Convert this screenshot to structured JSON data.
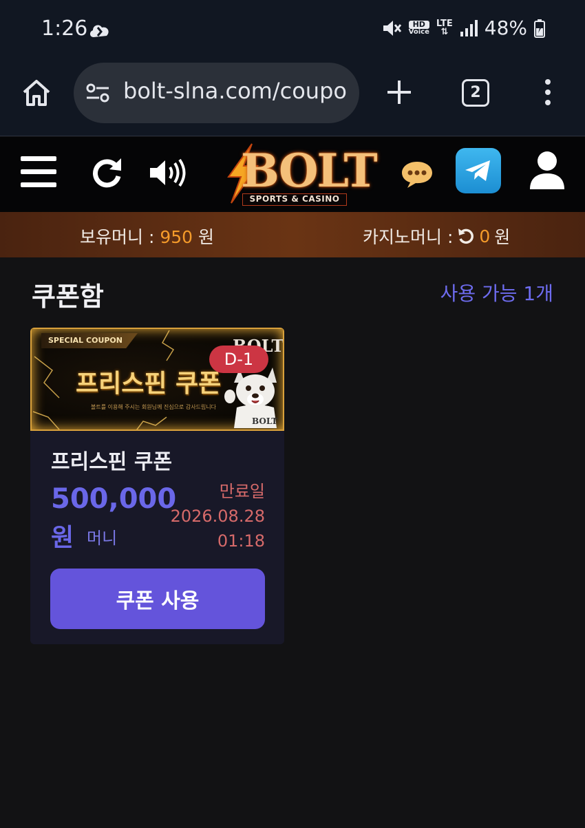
{
  "status_bar": {
    "time": "1:26",
    "battery": "48%",
    "hd_label": "HD",
    "voice_label": "Voice",
    "network": "LTE"
  },
  "browser": {
    "url": "bolt-slna.com/coupo",
    "tab_count": "2"
  },
  "header": {
    "logo_text": "BOLT",
    "logo_subtitle": "SPORTS & CASINO"
  },
  "money": {
    "holding_label": "보유머니 :",
    "holding_value": "950",
    "holding_unit": "원",
    "casino_label": "카지노머니 :",
    "casino_value": "0",
    "casino_unit": "원"
  },
  "coupon_box": {
    "title": "쿠폰함",
    "available": "사용 가능 1개"
  },
  "coupon": {
    "banner_tag": "SPECIAL COUPON",
    "banner_title": "프리스핀 쿠폰",
    "banner_brand": "BOLT",
    "banner_note": "볼트를 이용해 주시는 회원님께 진심으로 감사드립니다",
    "dday": "D-1",
    "name": "프리스핀 쿠폰",
    "amount": "500,000",
    "amount_unit": "원",
    "amount_type": "머니",
    "expiry_label": "만료일",
    "expiry_date": "2026.08.28",
    "expiry_time": "01:18",
    "use_button": "쿠폰 사용"
  },
  "colors": {
    "accent": "#6454db",
    "orange": "#f59b2a",
    "expiry": "#d66a6a",
    "dday": "#cc3543"
  }
}
